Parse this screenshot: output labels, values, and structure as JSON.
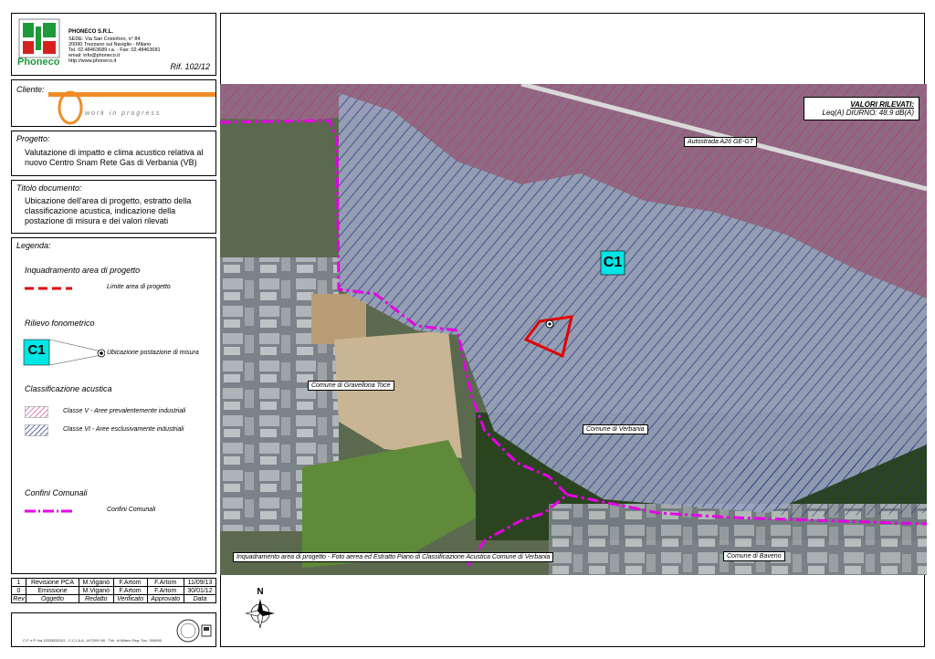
{
  "header": {
    "logo_text": "Phoneco",
    "company_name": "PHONECO S.R.L.",
    "address_lines": [
      "SEDE: Via San Cristoforo, n° 84",
      "20090 Trezzano sul Naviglio - Milano",
      "Tel. 02.48463689 r.a. - Fax: 02.48463681",
      "email: info@phoneco.it",
      "http://www.phoneco.it"
    ],
    "ref": "Rif. 102/12"
  },
  "client": {
    "label": "Cliente:",
    "logo_text": "work in progress"
  },
  "project": {
    "label": "Progetto:",
    "text": "Valutazione di impatto e clima acustico relativa al nuovo Centro Snam Rete Gas di Verbania (VB)"
  },
  "document_title": {
    "label": "Titolo documento:",
    "text": "Ubicazione dell'area di progetto, estratto della classificazione acustica, indicazione della postazione di misura e dei valori rilevati"
  },
  "legend": {
    "label": "Legenda:",
    "area_heading": "Inquadramento area di progetto",
    "area_item": "Limite area di progetto",
    "survey_heading": "Rilievo fonometrico",
    "survey_code": "C1",
    "survey_item": "Ubicazione postazione di misura",
    "class_heading": "Classificazione acustica",
    "class_v": "Classe V - Aree prevalentemente industriali",
    "class_vi": "Classe VI - Aree esclusivamente industriali",
    "boundaries_heading": "Confini Comunali",
    "boundaries_item": "Confini Comunali"
  },
  "revisions": {
    "rows": [
      [
        "1",
        "Revisione PCA",
        "M.Viganò",
        "F.Artom",
        "F.Artom",
        "11/09/13"
      ],
      [
        "0",
        "Emissione",
        "M.Viganò",
        "F.Artom",
        "F.Artom",
        "30/01/12"
      ]
    ],
    "headers": [
      "Rev",
      "Oggetto",
      "Redatto",
      "Verificato",
      "Approvato",
      "Data"
    ]
  },
  "footer": {
    "company_info": "C.F. e P. Iva 11533830151 - C.C.I.A.A. 1472000 MI - Trib. di Milano Reg. Soc. 354098"
  },
  "map": {
    "values_title": "VALORI RILEVATI:",
    "values_text": "Leq(A) DIURNO: 48.9 dB(A)",
    "station_code": "C1",
    "labels": {
      "highway": "Autostrada A26 GE-GT",
      "gravellona": "Comune di Gravellona Toce",
      "verbania": "Comune di Verbania",
      "baveno": "Comune di Baveno"
    },
    "caption": "Inquadramento area di progetto - Foto aerea ed Estratto Piano di Classificazione Acustica Comune di Verbania",
    "north_label": "N"
  },
  "colors": {
    "class_v": "#c0308f",
    "class_vi": "#1d2f8a",
    "boundary": "#e600e6",
    "project": "#e00000",
    "station": "#00e5e5",
    "accent": "#f08c28"
  }
}
